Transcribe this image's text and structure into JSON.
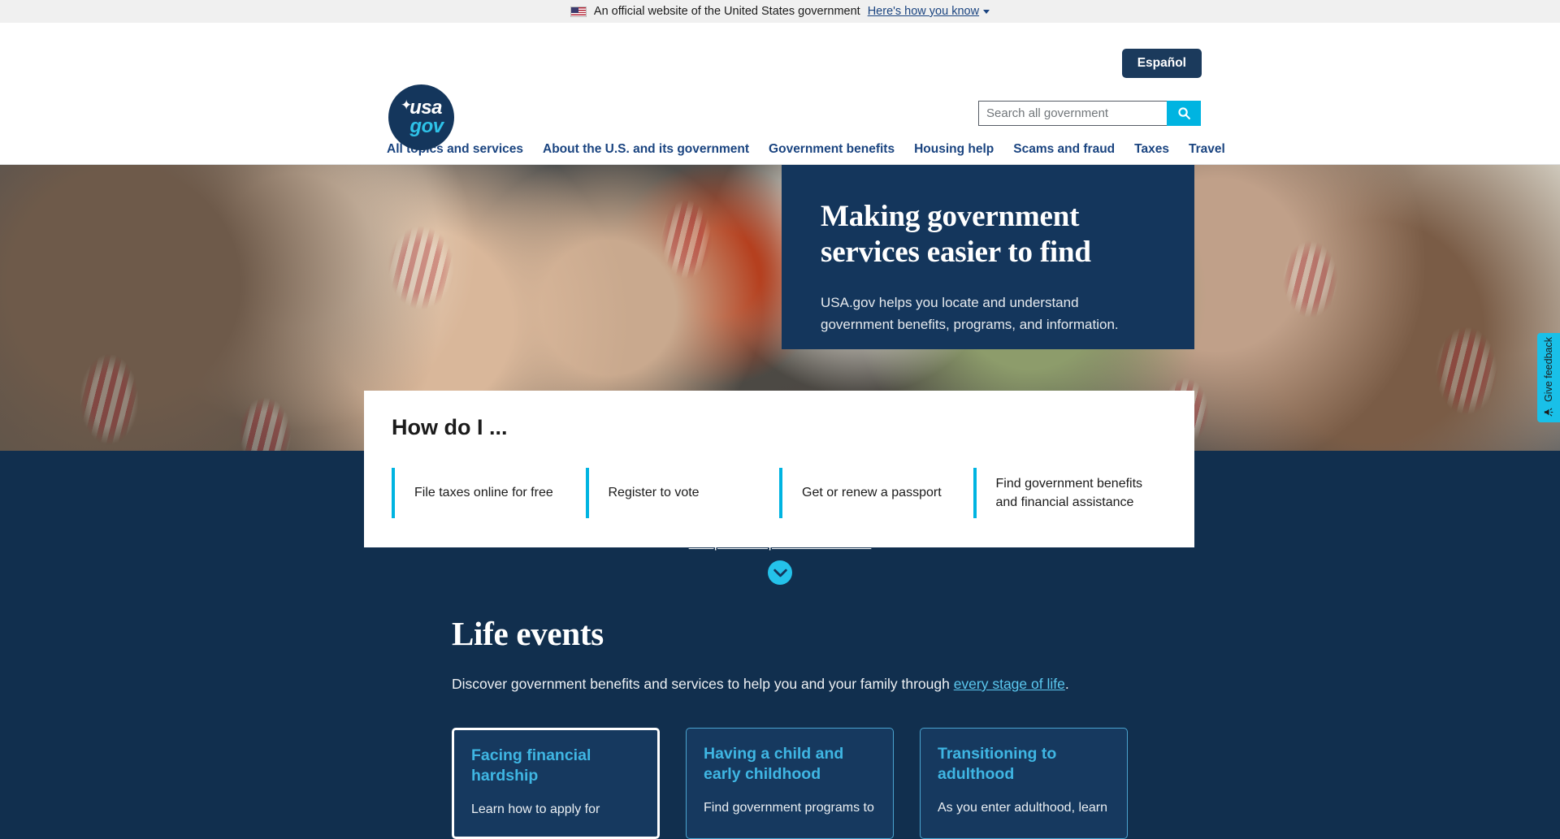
{
  "gov_banner": {
    "flag_icon": "us-flag-icon",
    "text": "An official website of the United States government",
    "link_label": "Here's how you know"
  },
  "header": {
    "espanol_label": "Español",
    "logo": {
      "line1": "usa",
      "line2": "gov",
      "star_icon": "star-icon"
    },
    "search": {
      "placeholder": "Search all government",
      "value": "",
      "button_icon": "search-icon",
      "button_color": "#00b4e1"
    }
  },
  "nav": {
    "items": [
      {
        "label": "All topics and services"
      },
      {
        "label": "About the U.S. and its government"
      },
      {
        "label": "Government benefits"
      },
      {
        "label": "Housing help"
      },
      {
        "label": "Scams and fraud"
      },
      {
        "label": "Taxes"
      },
      {
        "label": "Travel"
      }
    ]
  },
  "hero": {
    "title": "Making government services easier to find",
    "subtitle": "USA.gov helps you locate and understand government benefits, programs, and information.",
    "panel_color": "#14365c"
  },
  "how_do_i": {
    "title": "How do I ...",
    "accent_color": "#00b4e1",
    "links": [
      {
        "label": "File taxes online for free"
      },
      {
        "label": "Register to vote"
      },
      {
        "label": "Get or renew a passport"
      },
      {
        "label": "Find government benefits and financial assistance"
      }
    ]
  },
  "jump": {
    "label": "Jump to all topics and services",
    "chevron_icon": "chevron-down-icon",
    "circle_color": "#24c2ea"
  },
  "life_events": {
    "title": "Life events",
    "description_prefix": "Discover government benefits and services to help you and your family through ",
    "description_link": "every stage of life",
    "description_suffix": ".",
    "cards": [
      {
        "title": "Facing financial hardship",
        "description": "Learn how to apply for",
        "focused": true
      },
      {
        "title": "Having a child and early childhood",
        "description": "Find government programs to",
        "focused": false
      },
      {
        "title": "Transitioning to adulthood",
        "description": "As you enter adulthood, learn",
        "focused": false
      }
    ]
  },
  "feedback": {
    "label": "Give feedback",
    "icon": "megaphone-icon",
    "color": "#19c0e8"
  }
}
